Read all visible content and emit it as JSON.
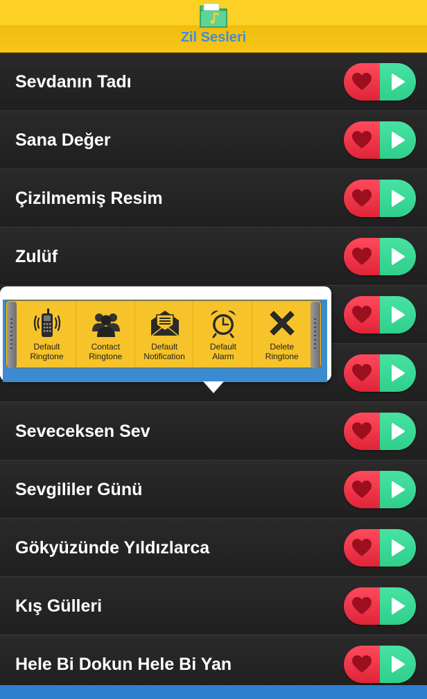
{
  "header": {
    "title": "Zil Sesleri",
    "logo_icon": "music-folder-icon"
  },
  "colors": {
    "header": "#fcd024",
    "title": "#3e8fd6",
    "fav": "#e83346",
    "play": "#3ad895",
    "popup_panel": "#3c8bd0",
    "tray": "#f6c32a"
  },
  "songs": [
    {
      "title": "Sevdanın Tadı"
    },
    {
      "title": "Sana Değer"
    },
    {
      "title": "Çizilmemiş Resim"
    },
    {
      "title": "Zulüf"
    },
    {
      "title": ""
    },
    {
      "title": ""
    },
    {
      "title": "Seveceksen Sev"
    },
    {
      "title": "Sevgililer Günü"
    },
    {
      "title": "Gökyüzünde Yıldızlarca"
    },
    {
      "title": "Kış Gülleri"
    },
    {
      "title": "Hele Bi Dokun Hele Bi Yan"
    }
  ],
  "popup": {
    "actions": [
      {
        "line1": "Default",
        "line2": "Ringtone",
        "icon": "phone-icon"
      },
      {
        "line1": "Contact",
        "line2": "Ringtone",
        "icon": "contacts-icon"
      },
      {
        "line1": "Default",
        "line2": "Notification",
        "icon": "envelope-icon"
      },
      {
        "line1": "Default",
        "line2": "Alarm",
        "icon": "alarm-clock-icon"
      },
      {
        "line1": "Delete",
        "line2": "Ringtone",
        "icon": "delete-x-icon"
      }
    ]
  }
}
